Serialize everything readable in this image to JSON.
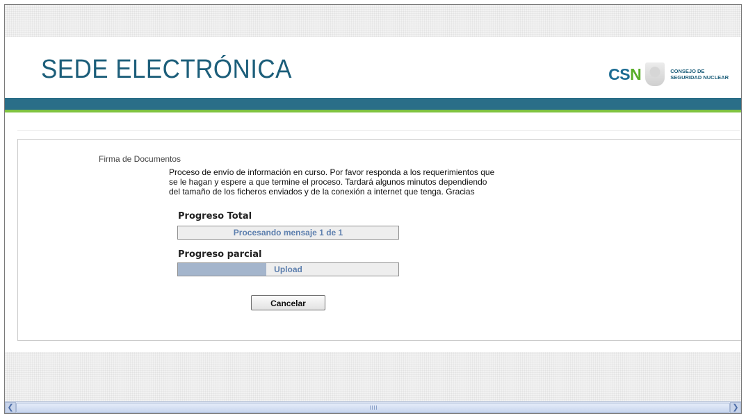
{
  "header": {
    "site_title": "SEDE ELECTRÓNICA",
    "logo": {
      "csn_c": "C",
      "csn_s": "S",
      "csn_n": "N",
      "line1": "CONSEJO DE",
      "line2": "SEGURIDAD NUCLEAR"
    }
  },
  "main": {
    "section_title": "Firma de Documentos",
    "info_lines": [
      "Proceso de envío de información en curso. Por favor responda a los requerimientos que",
      "se le hagan y espere a que termine el proceso. Tardará algunos minutos dependiendo",
      "del tamaño de los ficheros enviados y de la conexión a internet que tenga. Gracias"
    ],
    "total_progress": {
      "label": "Progreso Total",
      "text": "Procesando mensaje 1 de 1",
      "fraction": 0
    },
    "partial_progress": {
      "label": "Progreso parcial",
      "text": "Upload",
      "fraction": 0.4
    },
    "cancel_label": "Cancelar"
  },
  "colors": {
    "title": "#1c5e7a",
    "band_blue": "#2a6e88",
    "band_green": "#7fc340",
    "progress_text": "#5d7fae",
    "progress_fill": "#a4b5cc"
  },
  "scrollbar": {
    "left_icon": "chevron-left-icon",
    "right_icon": "chevron-right-icon"
  }
}
